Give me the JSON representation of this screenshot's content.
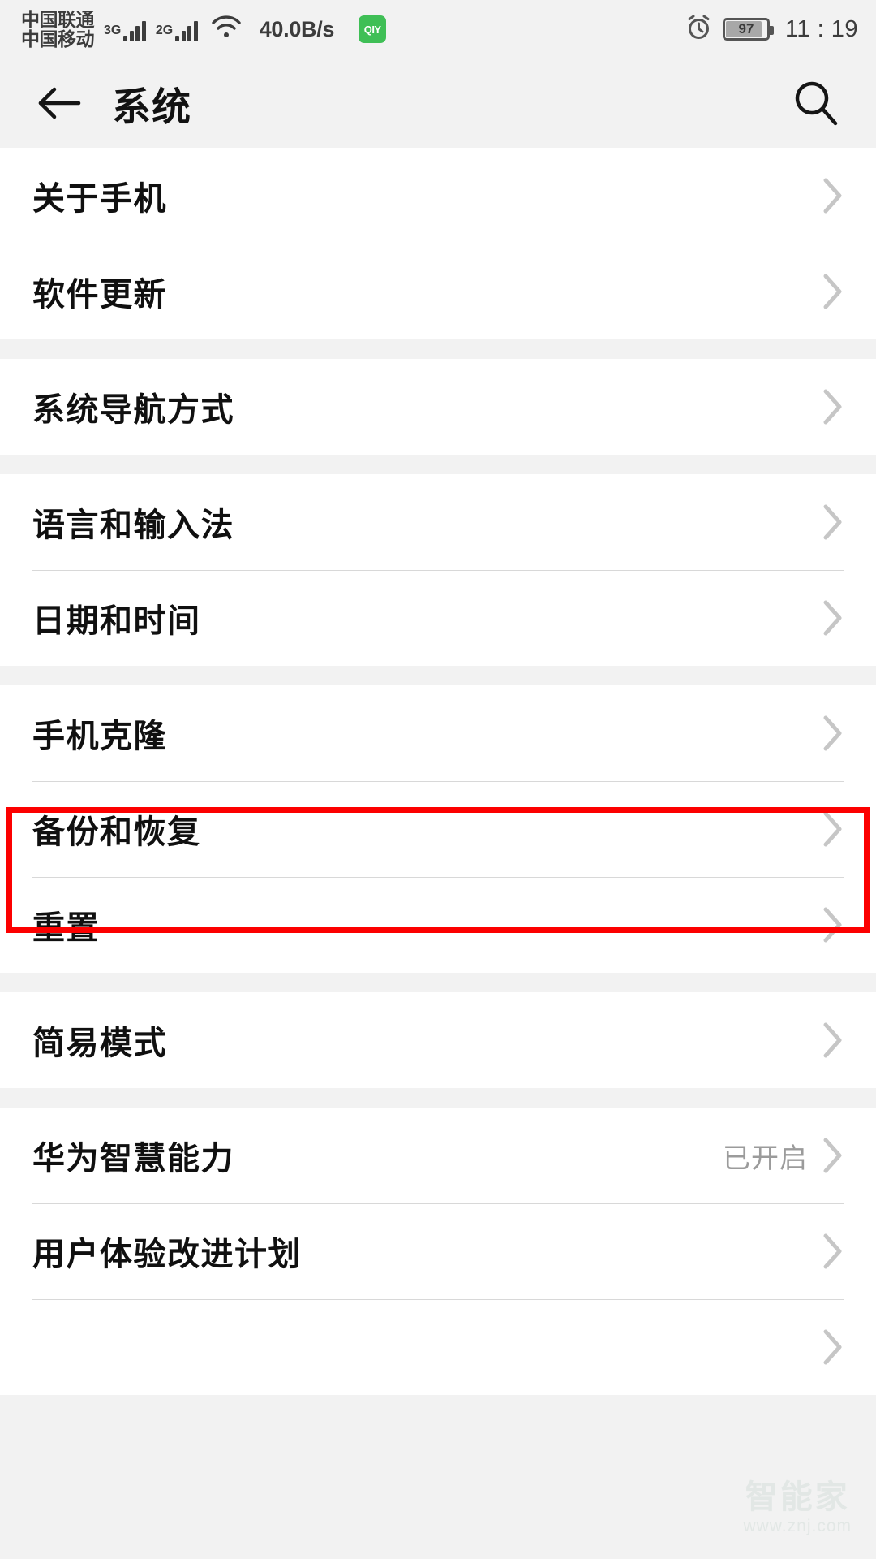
{
  "status_bar": {
    "carrier_line1": "中国联通",
    "carrier_line2": "中国移动",
    "sim1_generation": "3G",
    "sim2_generation": "2G",
    "network_speed": "40.0B/s",
    "app_badge_label": "QIY",
    "battery_percent": "97",
    "time": "11 : 19",
    "icons": [
      "signal-bars-icon",
      "wifi-icon",
      "alarm-clock-icon",
      "battery-icon"
    ]
  },
  "title_bar": {
    "back_icon": "back-arrow-icon",
    "title": "系统",
    "search_icon": "search-icon"
  },
  "highlight": {
    "color": "#fc0000",
    "target_label": "日期和时间"
  },
  "groups": [
    {
      "rows": [
        {
          "label": "关于手机",
          "value": ""
        },
        {
          "label": "软件更新",
          "value": ""
        }
      ]
    },
    {
      "rows": [
        {
          "label": "系统导航方式",
          "value": ""
        }
      ]
    },
    {
      "rows": [
        {
          "label": "语言和输入法",
          "value": ""
        },
        {
          "label": "日期和时间",
          "value": ""
        }
      ]
    },
    {
      "rows": [
        {
          "label": "手机克隆",
          "value": ""
        },
        {
          "label": "备份和恢复",
          "value": ""
        },
        {
          "label": "重置",
          "value": ""
        }
      ]
    },
    {
      "rows": [
        {
          "label": "简易模式",
          "value": ""
        }
      ]
    },
    {
      "rows": [
        {
          "label": "华为智慧能力",
          "value": "已开启"
        },
        {
          "label": "用户体验改进计划",
          "value": ""
        },
        {
          "label": "",
          "value": ""
        }
      ]
    }
  ],
  "watermark": {
    "main": "智能家",
    "sub": "www.znj.com"
  }
}
